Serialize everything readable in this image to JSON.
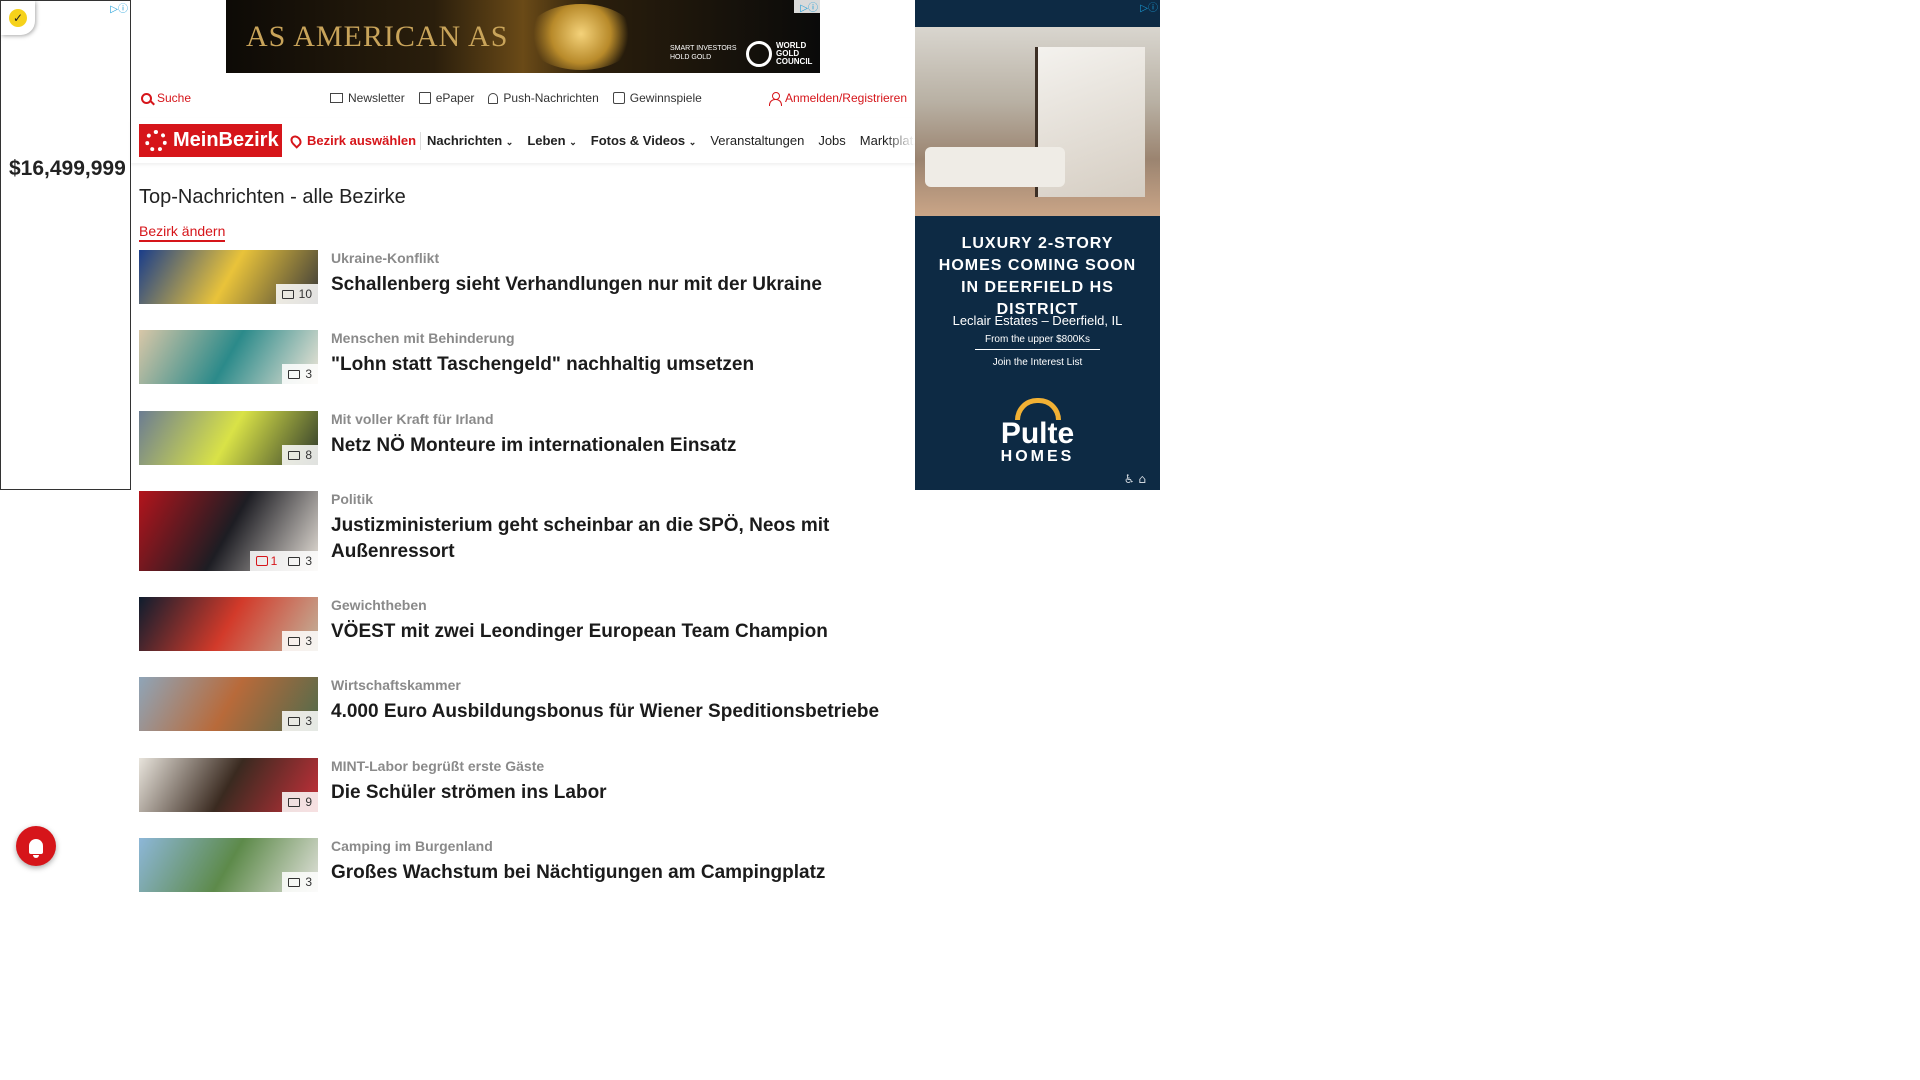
{
  "ads": {
    "left": {
      "price": "$16,499,999",
      "badge_icon": "check-badge-icon"
    },
    "top": {
      "headline": "AS AMERICAN AS",
      "tagline": "SMART INVESTORS\nHOLD GOLD",
      "logo_text": "WORLD GOLD COUNCIL"
    },
    "right": {
      "headline": "LUXURY 2-STORY HOMES COMING SOON IN DEERFIELD HS DISTRICT",
      "location": "Leclair Estates – Deerfield, IL",
      "price": "From the upper $800Ks",
      "cta": "Join the Interest List",
      "brand": "Pulte",
      "brand_sub": "HOMES"
    }
  },
  "utility": {
    "search": "Suche",
    "links": [
      "Newsletter",
      "ePaper",
      "Push-Nachrichten",
      "Gewinnspiele"
    ],
    "login": "Anmelden/Registrieren"
  },
  "nav": {
    "logo": "MeinBezirk",
    "bezirk": "Bezirk auswählen",
    "items": [
      {
        "label": "Nachrichten",
        "dropdown": true
      },
      {
        "label": "Leben",
        "dropdown": true
      },
      {
        "label": "Fotos & Videos",
        "dropdown": true
      },
      {
        "label": "Veranstaltungen",
        "dropdown": false
      },
      {
        "label": "Jobs",
        "dropdown": false
      },
      {
        "label": "Marktplatz",
        "dropdown": false
      }
    ]
  },
  "page": {
    "title": "Top-Nachrichten - alle Bezirke",
    "change_bezirk": "Bezirk ändern"
  },
  "articles": [
    {
      "kicker": "Ukraine-Konflikt",
      "headline": "Schallenberg sieht Verhandlungen nur mit der Ukraine",
      "images": "10",
      "comments": null,
      "colors": [
        "#1a3d8a",
        "#e9c33a",
        "#3a3a3a"
      ]
    },
    {
      "kicker": "Menschen mit Behinderung",
      "headline": "\"Lohn statt Taschengeld\" nachhaltig umsetzen",
      "images": "3",
      "comments": null,
      "colors": [
        "#d8c7a8",
        "#2b8a8a",
        "#f0e6d8"
      ]
    },
    {
      "kicker": "Mit voller Kraft für Irland",
      "headline": "Netz NÖ Monteure im internationalen Einsatz",
      "images": "8",
      "comments": null,
      "colors": [
        "#6b7c92",
        "#d9e247",
        "#2f3a2c"
      ]
    },
    {
      "kicker": "Politik",
      "headline": "Justizministerium geht scheinbar an die SPÖ, Neos mit Außenressort",
      "images": "3",
      "comments": "1",
      "colors": [
        "#b3141c",
        "#1d1d23",
        "#e8e2da"
      ]
    },
    {
      "kicker": "Gewichtheben",
      "headline": "VÖEST mit zwei Leondinger European Team Champion",
      "images": "3",
      "comments": null,
      "colors": [
        "#0f1d2e",
        "#d23a2a",
        "#c2b49c"
      ]
    },
    {
      "kicker": "Wirtschaftskammer",
      "headline": "4.000 Euro Ausbildungsbonus für Wiener Speditionsbetriebe",
      "images": "3",
      "comments": null,
      "colors": [
        "#8fa5b8",
        "#b86a3a",
        "#4f6b4c"
      ]
    },
    {
      "kicker": "MINT-Labor begrüßt erste Gäste",
      "headline": "Die Schüler strömen ins Labor",
      "images": "9",
      "comments": null,
      "colors": [
        "#e8e4dc",
        "#3a2a20",
        "#c7303a"
      ]
    },
    {
      "kicker": "Camping im Burgenland",
      "headline": "Großes Wachstum bei Nächtigungen am Campingplatz",
      "images": "3",
      "comments": null,
      "colors": [
        "#8db7d8",
        "#5d8a4a",
        "#e2e2dc"
      ]
    }
  ],
  "colors": {
    "brand_red": "#d6151a"
  }
}
